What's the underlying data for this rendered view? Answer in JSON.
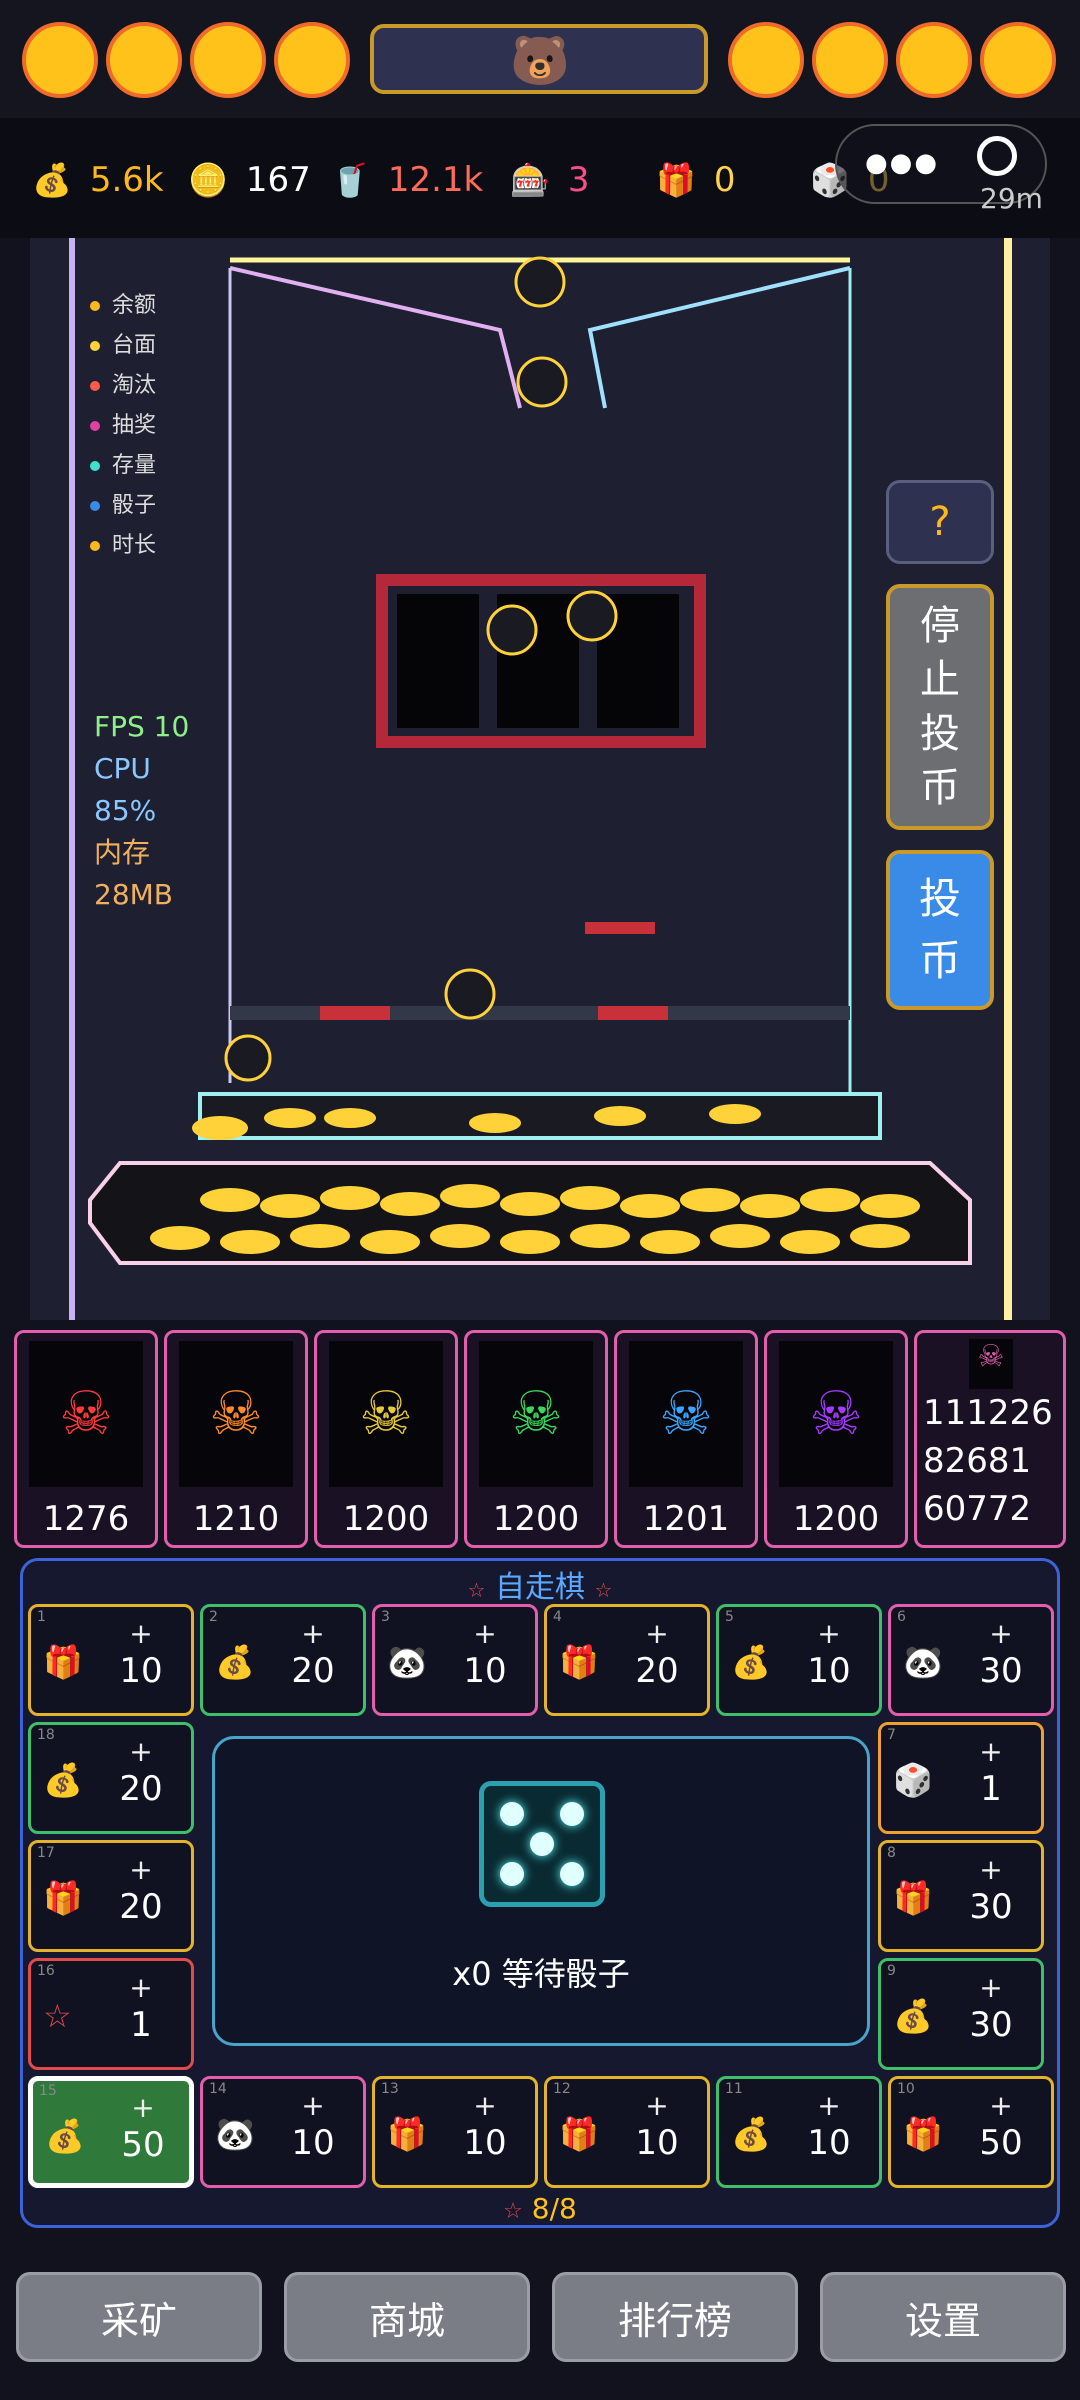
{
  "stats": [
    {
      "icon": "💰",
      "value": "5.6k",
      "color": "#ffb81c"
    },
    {
      "icon": "🪙",
      "value": "167",
      "color": "#ffffff"
    },
    {
      "icon": "🥤",
      "value": "12.1k",
      "color": "#ff6b5a"
    },
    {
      "icon": "🎰",
      "value": "3",
      "color": "#ff4d8a"
    },
    {
      "icon": "🎁",
      "value": "0",
      "color": "#ffd34d"
    },
    {
      "icon": "🎲",
      "value": "0",
      "color": "#ffd34d"
    }
  ],
  "timer": "29m",
  "legend": [
    "余额",
    "台面",
    "淘汰",
    "抽奖",
    "存量",
    "骰子",
    "时长"
  ],
  "perf": {
    "fps": "FPS 10",
    "cpu_label": "CPU",
    "cpu_value": "85%",
    "mem_label": "内存",
    "mem_value": "28MB"
  },
  "side_buttons": {
    "help": "?",
    "stop": "停止投币",
    "coin": "投币"
  },
  "characters": [
    {
      "value": "1276",
      "color": "#ff3a3a"
    },
    {
      "value": "1210",
      "color": "#ff8a2a"
    },
    {
      "value": "1200",
      "color": "#e8c93a"
    },
    {
      "value": "1200",
      "color": "#3ad85a"
    },
    {
      "value": "1201",
      "color": "#3aa5ff"
    },
    {
      "value": "1200",
      "color": "#a53aff"
    }
  ],
  "char_totals": [
    "111226",
    "82681",
    "60772"
  ],
  "board": {
    "title": "自走棋",
    "center_text": "x0 等待骰子",
    "progress": "8/8",
    "tiles": [
      {
        "idx": "1",
        "icon": "🎁",
        "amt": "10",
        "border": "#e3b42a"
      },
      {
        "idx": "2",
        "icon": "💰",
        "amt": "20",
        "border": "#3fbf6a"
      },
      {
        "idx": "3",
        "icon": "🐼",
        "amt": "10",
        "border": "#e35fae"
      },
      {
        "idx": "4",
        "icon": "🎁",
        "amt": "20",
        "border": "#e3b42a"
      },
      {
        "idx": "5",
        "icon": "💰",
        "amt": "10",
        "border": "#3fbf6a"
      },
      {
        "idx": "6",
        "icon": "🐼",
        "amt": "30",
        "border": "#e35fae"
      },
      {
        "idx": "7",
        "icon": "🎲",
        "amt": "1",
        "border": "#f0a030"
      },
      {
        "idx": "8",
        "icon": "🎁",
        "amt": "30",
        "border": "#e3b42a"
      },
      {
        "idx": "9",
        "icon": "💰",
        "amt": "30",
        "border": "#3fbf6a"
      },
      {
        "idx": "10",
        "icon": "🎁",
        "amt": "50",
        "border": "#e3b42a"
      },
      {
        "idx": "11",
        "icon": "💰",
        "amt": "10",
        "border": "#3fbf6a"
      },
      {
        "idx": "12",
        "icon": "🎁",
        "amt": "10",
        "border": "#e3b42a"
      },
      {
        "idx": "13",
        "icon": "🎁",
        "amt": "10",
        "border": "#e3b42a"
      },
      {
        "idx": "14",
        "icon": "🐼",
        "amt": "10",
        "border": "#e35fae"
      },
      {
        "idx": "15",
        "icon": "💰",
        "amt": "50",
        "border": "#ffffff"
      },
      {
        "idx": "16",
        "icon": "☆",
        "amt": "1",
        "border": "#e34a4a"
      },
      {
        "idx": "17",
        "icon": "🎁",
        "amt": "20",
        "border": "#e3b42a"
      },
      {
        "idx": "18",
        "icon": "💰",
        "amt": "20",
        "border": "#3fbf6a"
      }
    ]
  },
  "nav": [
    "采矿",
    "商城",
    "排行榜",
    "设置"
  ]
}
